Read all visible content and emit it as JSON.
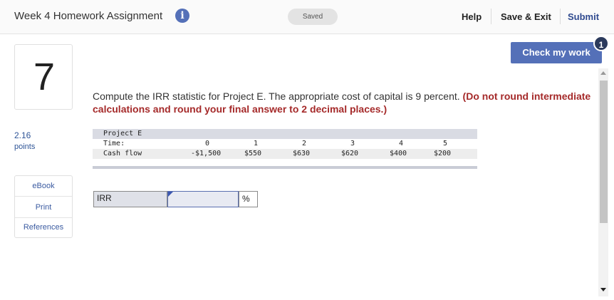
{
  "header": {
    "title": "Week 4 Homework Assignment",
    "info_icon": "i",
    "status": "Saved",
    "help": "Help",
    "save_exit": "Save & Exit",
    "submit": "Submit"
  },
  "question": {
    "number": "7",
    "points_value": "2.16",
    "points_label": "points",
    "text": "Compute the IRR statistic for Project E. The appropriate cost of capital is 9 percent. ",
    "instruction": "(Do not round intermediate calculations and round your final answer to 2 decimal places.)"
  },
  "sidebar": {
    "links": [
      "eBook",
      "Print",
      "References"
    ]
  },
  "check": {
    "label": "Check my work",
    "badge": "1"
  },
  "cashflow_table": {
    "title": "Project E",
    "time_label": "Time:",
    "cash_label": "Cash flow",
    "times": [
      "0",
      "1",
      "2",
      "3",
      "4",
      "5"
    ],
    "flows": [
      "-$1,500",
      "$550",
      "$630",
      "$620",
      "$400",
      "$200"
    ]
  },
  "answer": {
    "label": "IRR",
    "value": "",
    "unit": "%"
  },
  "colors": {
    "accent": "#5470b8",
    "instruction_red": "#a52a2a",
    "link_blue": "#2f5597"
  }
}
